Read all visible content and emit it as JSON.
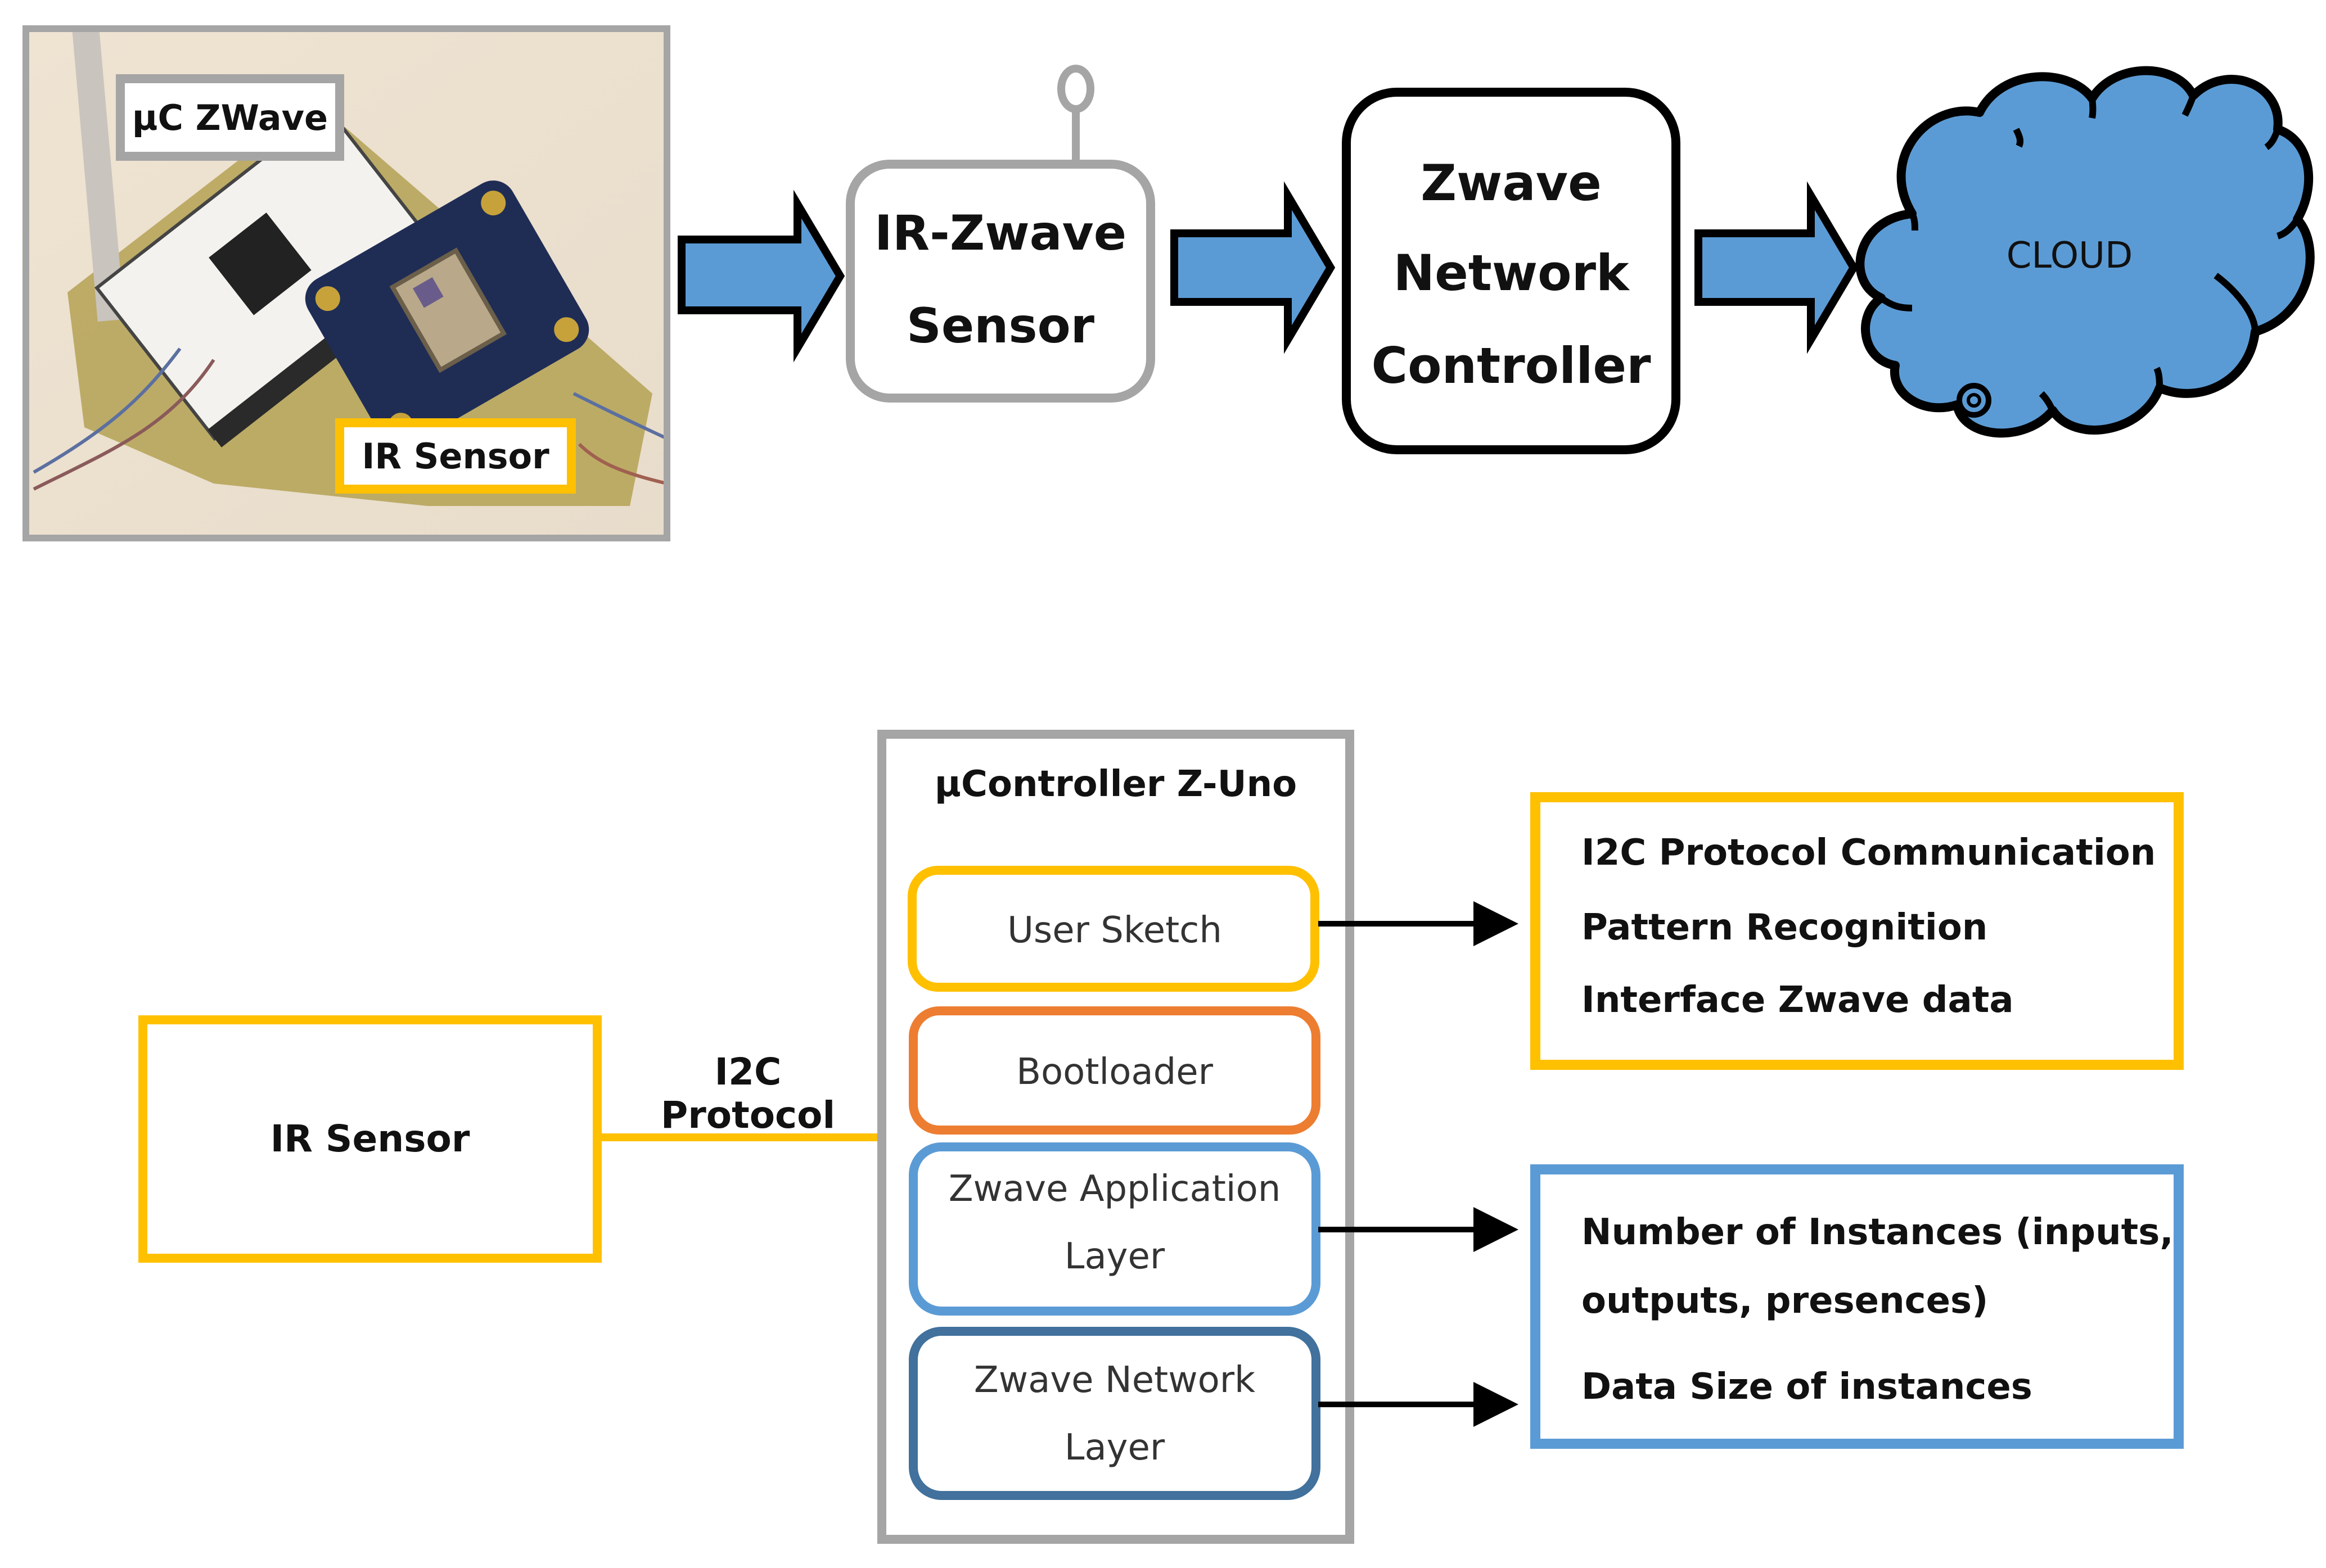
{
  "top_flow": {
    "photo": {
      "labels": {
        "microcontroller": "µC ZWave",
        "ir_sensor": "IR Sensor"
      }
    },
    "sensor_node": {
      "line1": "IR-Zwave",
      "line2": "Sensor"
    },
    "controller": {
      "line1": "Zwave",
      "line2": "Network",
      "line3": "Controller"
    },
    "cloud": {
      "label": "CLOUD"
    }
  },
  "architecture": {
    "ir_sensor": {
      "label": "IR Sensor"
    },
    "link_label": "I2C Protocol",
    "controller": {
      "title": "µController Z-Uno",
      "layers": [
        {
          "line1": "User Sketch",
          "line2": "",
          "color": "#FFC000"
        },
        {
          "line1": "Bootloader",
          "line2": "",
          "color": "#ED7D31"
        },
        {
          "line1": "Zwave Application",
          "line2": "Layer",
          "color": "#5B9BD5"
        },
        {
          "line1": "Zwave Network",
          "line2": "Layer",
          "color": "#41719C"
        }
      ]
    },
    "sketch_functions": {
      "items": [
        "I2C Protocol Communication",
        "Pattern Recognition",
        "Interface Zwave data"
      ],
      "color": "#FFC000"
    },
    "zwave_parameters": {
      "items": [
        "Number of Instances (inputs,",
        "outputs, presences)",
        "Data Size of instances"
      ],
      "color": "#5B9BD5"
    }
  },
  "colors": {
    "arrow_fill": "#5B9BD5",
    "cloud_fill": "#5B9BD5",
    "frame_gray": "#A5A5A5",
    "yellow": "#FFC000",
    "orange": "#ED7D31",
    "blue": "#5B9BD5",
    "dark_blue": "#41719C"
  }
}
